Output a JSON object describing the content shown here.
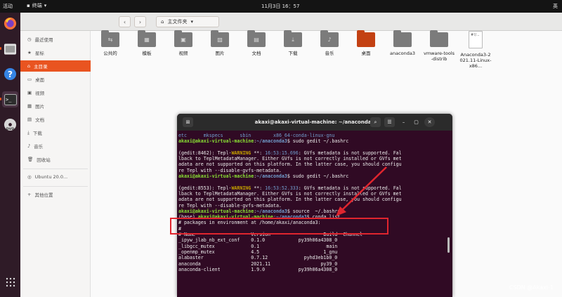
{
  "topbar": {
    "activities": "活动",
    "app_name": "终端",
    "clock": "11月3日 16：57",
    "input_method": "英"
  },
  "dock": {
    "items": [
      "firefox-icon",
      "files-icon",
      "help-icon",
      "terminal-icon",
      "dvd-icon",
      "apps-grid-icon"
    ]
  },
  "files": {
    "path_label": "主文件夹",
    "sidebar": [
      {
        "label": "最近使用",
        "icon": "clock-icon",
        "active": false
      },
      {
        "label": "星标",
        "icon": "star-icon",
        "active": false
      },
      {
        "label": "主目录",
        "icon": "home-icon",
        "active": true
      },
      {
        "label": "桌面",
        "icon": "desktop-icon",
        "active": false
      },
      {
        "label": "视频",
        "icon": "video-icon",
        "active": false
      },
      {
        "label": "图片",
        "icon": "picture-icon",
        "active": false
      },
      {
        "label": "文档",
        "icon": "document-icon",
        "active": false
      },
      {
        "label": "下载",
        "icon": "download-icon",
        "active": false
      },
      {
        "label": "音乐",
        "icon": "music-icon",
        "active": false
      },
      {
        "label": "回收站",
        "icon": "trash-icon",
        "active": false
      },
      {
        "label": "Ubuntu 20.0...",
        "icon": "disc-icon",
        "active": false
      },
      {
        "label": "其他位置",
        "icon": "plus-icon",
        "active": false
      }
    ],
    "items": [
      {
        "name": "公共的",
        "kind": "folder",
        "icon": "share-icon"
      },
      {
        "name": "模板",
        "kind": "folder",
        "icon": "template-icon"
      },
      {
        "name": "视频",
        "kind": "folder",
        "icon": "video-icon"
      },
      {
        "name": "图片",
        "kind": "folder",
        "icon": "picture-icon"
      },
      {
        "name": "文档",
        "kind": "folder",
        "icon": "document-icon"
      },
      {
        "name": "下载",
        "kind": "folder",
        "icon": "download-icon"
      },
      {
        "name": "音乐",
        "kind": "folder",
        "icon": "music-icon"
      },
      {
        "name": "桌面",
        "kind": "desktop",
        "icon": "desktop-icon"
      },
      {
        "name": "anaconda3",
        "kind": "folder",
        "icon": "folder-icon"
      },
      {
        "name": "vmware-tools-distrib",
        "kind": "folder",
        "icon": "folder-icon"
      },
      {
        "name": "Anaconda3-2021.11-Linux-x86...",
        "kind": "file",
        "icon": "script-file-icon",
        "file_text": "#!/..."
      }
    ]
  },
  "terminal": {
    "title": "akaxi@akaxi-virtual-machine: ~/anaconda3",
    "lines": [
      {
        "segments": [
          [
            "etc",
            "c-blue"
          ],
          [
            "      ",
            ""
          ],
          [
            "mkspecs",
            "c-blue"
          ],
          [
            "      ",
            ""
          ],
          [
            "sbin",
            "c-blue"
          ],
          [
            "        ",
            ""
          ],
          [
            "x86_64-conda-linux-gnu",
            "c-blue"
          ]
        ]
      },
      {
        "segments": [
          [
            "akaxi@akaxi-virtual-machine",
            "p-user"
          ],
          [
            ":",
            ""
          ],
          [
            "~/anaconda3",
            "p-path"
          ],
          [
            "$ sudo gedit ~/.bashrc",
            ""
          ]
        ]
      },
      {
        "segments": []
      },
      {
        "segments": [
          [
            "(gedit:8462): Tepl-",
            ""
          ],
          [
            "WARNING",
            "warn"
          ],
          [
            " **: ",
            ""
          ],
          [
            "16:53:15.696",
            "c-blue"
          ],
          [
            ": GVfs metadata is not supported. Fal",
            ""
          ]
        ]
      },
      {
        "segments": [
          [
            "lback to TeplMetadataManager. Either GVfs is not correctly installed or GVfs met",
            ""
          ]
        ]
      },
      {
        "segments": [
          [
            "adata are not supported on this platform. In the latter case, you should configu",
            ""
          ]
        ]
      },
      {
        "segments": [
          [
            "re Tepl with --disable-gvfs-metadata.",
            ""
          ]
        ]
      },
      {
        "segments": [
          [
            "akaxi@akaxi-virtual-machine",
            "p-user"
          ],
          [
            ":",
            ""
          ],
          [
            "~/anaconda3",
            "p-path"
          ],
          [
            "$ sudo gedit ~/.bashrc",
            ""
          ]
        ]
      },
      {
        "segments": []
      },
      {
        "segments": [
          [
            "(gedit:8553): Tepl-",
            ""
          ],
          [
            "WARNING",
            "warn"
          ],
          [
            " **: ",
            ""
          ],
          [
            "16:53:52.333",
            "c-blue"
          ],
          [
            ": GVfs metadata is not supported. Fal",
            ""
          ]
        ]
      },
      {
        "segments": [
          [
            "lback to TeplMetadataManager. Either GVfs is not correctly installed or GVfs met",
            ""
          ]
        ]
      },
      {
        "segments": [
          [
            "adata are not supported on this platform. In the latter case, you should configu",
            ""
          ]
        ]
      },
      {
        "segments": [
          [
            "re Tepl with --disable-gvfs-metadata.",
            ""
          ]
        ]
      },
      {
        "segments": [
          [
            "akaxi@akaxi-virtual-machine",
            "p-user"
          ],
          [
            ":",
            ""
          ],
          [
            "~/anaconda3",
            "p-path"
          ],
          [
            "$ source  ~/.bashrc",
            ""
          ]
        ]
      },
      {
        "segments": [
          [
            "(base) ",
            ""
          ],
          [
            "akaxi@akaxi-virtual-machine",
            "p-user"
          ],
          [
            ":",
            ""
          ],
          [
            "~/anaconda3",
            "p-path"
          ],
          [
            "$ conda list",
            ""
          ]
        ]
      },
      {
        "segments": [
          [
            "# packages in environment at /home/akaxi/anaconda3:",
            ""
          ]
        ]
      },
      {
        "segments": [
          [
            "#",
            ""
          ]
        ]
      },
      {
        "segments": [
          [
            "# Name                    Version                   Build  Channel",
            ""
          ]
        ]
      },
      {
        "segments": [
          [
            "_ipyw_jlab_nb_ext_conf    0.1.0            py39h06a4308_0",
            ""
          ]
        ]
      },
      {
        "segments": [
          [
            "_libgcc_mutex             0.1                        main",
            ""
          ]
        ]
      },
      {
        "segments": [
          [
            "_openmp_mutex             4.5                       1_gnu",
            ""
          ]
        ]
      },
      {
        "segments": [
          [
            "alabaster                 0.7.12             pyhd3eb1b0_0",
            ""
          ]
        ]
      },
      {
        "segments": [
          [
            "anaconda                  2021.11                  py39_0",
            ""
          ]
        ]
      },
      {
        "segments": [
          [
            "anaconda-client           1.9.0            py39h06a4308_0",
            ""
          ]
        ]
      }
    ]
  },
  "watermark": "CSDN @Akaxi-1",
  "colors": {
    "accent": "#e95420",
    "terminal_bg": "#300a24",
    "prompt_user": "#8ae234",
    "prompt_path": "#729fcf",
    "highlight_red": "#e0252e"
  }
}
